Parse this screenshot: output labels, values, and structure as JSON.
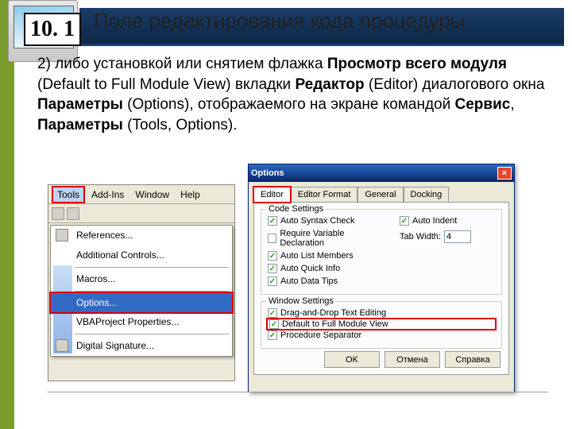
{
  "slide_number": "10. 1",
  "header_title": "Поле редактирования кода процедуры",
  "body_html": "2) либо установкой или снятием флажка <b>Просмотр всего модуля</b> (Default to Full Module View) вкладки <b>Редактор</b> (Editor) диалогового окна <b>Параметры</b> (Options), отображаемого на экране командой <b>Сервис</b>, <b>Параметры</b> (Tools, Options).",
  "menu": {
    "bar": [
      "Tools",
      "Add-Ins",
      "Window",
      "Help"
    ],
    "items": [
      "References...",
      "Additional Controls...",
      "Macros...",
      "Options...",
      "VBAProject Properties...",
      "Digital Signature..."
    ]
  },
  "options": {
    "title": "Options",
    "tabs": [
      "Editor",
      "Editor Format",
      "General",
      "Docking"
    ],
    "code_settings_title": "Code Settings",
    "code_settings": [
      {
        "label": "Auto Syntax Check",
        "checked": true
      },
      {
        "label": "Require Variable Declaration",
        "checked": false
      },
      {
        "label": "Auto List Members",
        "checked": true
      },
      {
        "label": "Auto Quick Info",
        "checked": true
      },
      {
        "label": "Auto Data Tips",
        "checked": true
      }
    ],
    "auto_indent": {
      "label": "Auto Indent",
      "checked": true
    },
    "tab_width": {
      "label": "Tab Width:",
      "value": "4"
    },
    "window_settings_title": "Window Settings",
    "window_settings": [
      {
        "label": "Drag-and-Drop Text Editing",
        "checked": true
      },
      {
        "label": "Default to Full Module View",
        "checked": true,
        "highlight": true
      },
      {
        "label": "Procedure Separator",
        "checked": true
      }
    ],
    "buttons": [
      "OK",
      "Отмена",
      "Справка"
    ]
  }
}
